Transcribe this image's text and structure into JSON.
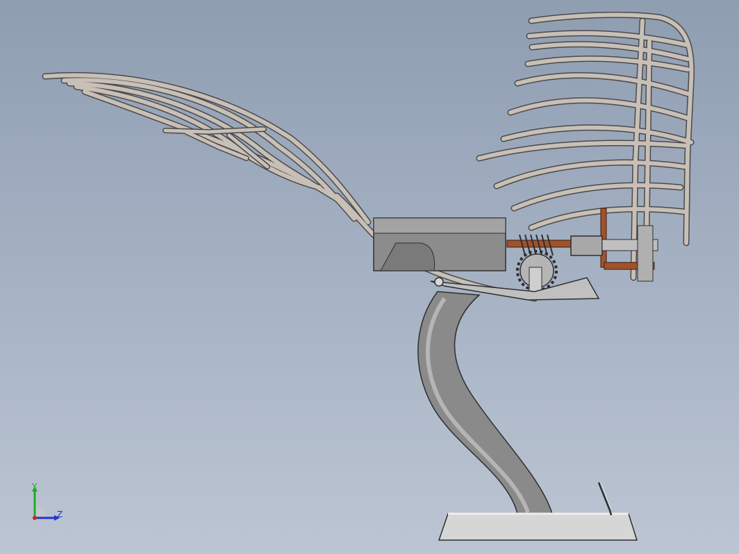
{
  "viewport": {
    "background_top": "#8f9db1",
    "background_bottom": "#bcc5d3"
  },
  "model": {
    "frame_color": "#c8bfb7",
    "frame_stroke": "#4a4a4a",
    "body_color": "#8c8c8c",
    "shaft_color": "#a0522d",
    "base_color": "#d9d9d9"
  },
  "triad": {
    "y_label": "Y",
    "z_label": "Z",
    "y_color": "#22aa22",
    "z_color": "#2233cc",
    "x_color": "#cc2222"
  }
}
